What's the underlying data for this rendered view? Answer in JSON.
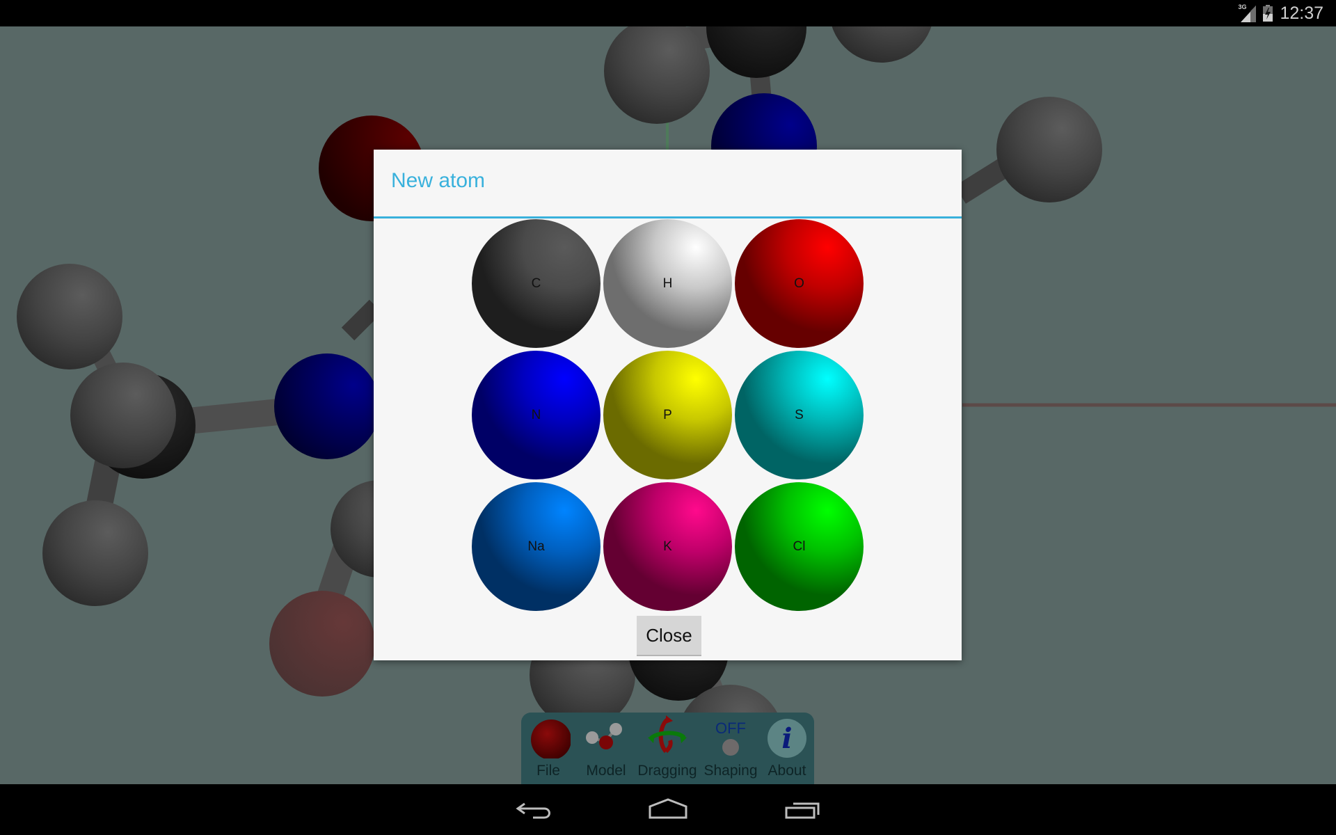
{
  "status_bar": {
    "network": "3G",
    "time": "12:37",
    "icons": [
      "signal-icon",
      "battery-charging-icon"
    ]
  },
  "scene": {
    "background": "#586866",
    "description": "3D ball-and-stick molecule model (dimmed behind dialog)"
  },
  "dialog": {
    "title": "New atom",
    "accent_color": "#39b1dc",
    "atoms": [
      {
        "symbol": "C",
        "color": "#4a4a4a",
        "dark": "#1e1e1e",
        "light": "#5a5a5a"
      },
      {
        "symbol": "H",
        "color": "#c8c8c8",
        "dark": "#6e6e6e",
        "light": "#ffffff"
      },
      {
        "symbol": "O",
        "color": "#c00000",
        "dark": "#660000",
        "light": "#ff0000"
      },
      {
        "symbol": "N",
        "color": "#0000c0",
        "dark": "#000066",
        "light": "#0000ff"
      },
      {
        "symbol": "P",
        "color": "#c8c800",
        "dark": "#6b6b00",
        "light": "#ffff00"
      },
      {
        "symbol": "S",
        "color": "#00b8b8",
        "dark": "#006464",
        "light": "#00ffff"
      },
      {
        "symbol": "Na",
        "color": "#0060c0",
        "dark": "#003064",
        "light": "#0084ff"
      },
      {
        "symbol": "K",
        "color": "#c0006a",
        "dark": "#640032",
        "light": "#ff0a8c"
      },
      {
        "symbol": "Cl",
        "color": "#00c000",
        "dark": "#006400",
        "light": "#00ff00"
      }
    ],
    "close_label": "Close"
  },
  "toolbar": {
    "items": [
      {
        "label": "File",
        "icon": "red-ball-icon"
      },
      {
        "label": "Model",
        "icon": "molecule-icon"
      },
      {
        "label": "Dragging",
        "icon": "rotate-arrows-icon"
      },
      {
        "label": "Shaping",
        "icon": "toggle-off-icon",
        "state": "OFF"
      },
      {
        "label": "About",
        "icon": "info-icon",
        "glyph": "i"
      }
    ]
  },
  "nav_bar": {
    "buttons": [
      "back",
      "home",
      "recents"
    ]
  }
}
